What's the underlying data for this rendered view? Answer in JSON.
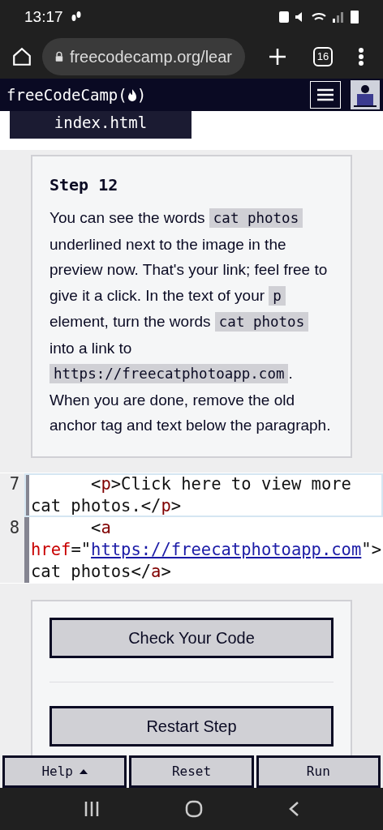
{
  "status_bar": {
    "time": "13:17"
  },
  "browser": {
    "url": "freecodecamp.org/lear",
    "tab_count": "16"
  },
  "nav": {
    "logo": "freeCodeCamp(",
    "logo_end": ")"
  },
  "file_tab": {
    "label": "index.html"
  },
  "step": {
    "title": "Step 12",
    "description": [
      {
        "text": "You can see the words ",
        "code": false
      },
      {
        "text": "cat photos",
        "code": true
      },
      {
        "text": " underlined next to the image in the preview now. That's your link; feel free to give it a click. In the text of your ",
        "code": false
      },
      {
        "text": "p",
        "code": true
      },
      {
        "text": " element, turn the words ",
        "code": false
      },
      {
        "text": "cat photos",
        "code": true
      },
      {
        "text": " into a link to ",
        "code": false
      },
      {
        "text": "https://freecatphotoapp.com",
        "code": true
      },
      {
        "text": ". When you are done, remove the old anchor tag and text below the paragraph.",
        "code": false
      }
    ]
  },
  "editor": {
    "lines": [
      {
        "number": "7",
        "selected": true,
        "tokens": [
          {
            "kind": "text",
            "text": "      <"
          },
          {
            "kind": "tag",
            "text": "p"
          },
          {
            "kind": "text",
            "text": ">Click here to view more cat photos.</"
          },
          {
            "kind": "tag",
            "text": "p"
          },
          {
            "kind": "text",
            "text": ">"
          }
        ]
      },
      {
        "number": "8",
        "selected": false,
        "tokens": [
          {
            "kind": "text",
            "text": "      <"
          },
          {
            "kind": "tag",
            "text": "a"
          },
          {
            "kind": "attr",
            "text": " href"
          },
          {
            "kind": "text",
            "text": "=\""
          },
          {
            "kind": "link",
            "text": "https://freecatphotoapp.com"
          },
          {
            "kind": "text",
            "text": "\">cat photos</"
          },
          {
            "kind": "tag",
            "text": "a"
          },
          {
            "kind": "text",
            "text": ">"
          }
        ]
      }
    ]
  },
  "actions": [
    "Check Your Code",
    "Restart Step"
  ],
  "bottom_bar": [
    {
      "label": "Help",
      "caret": true
    },
    {
      "label": "Reset",
      "caret": false
    },
    {
      "label": "Run",
      "caret": false
    }
  ]
}
